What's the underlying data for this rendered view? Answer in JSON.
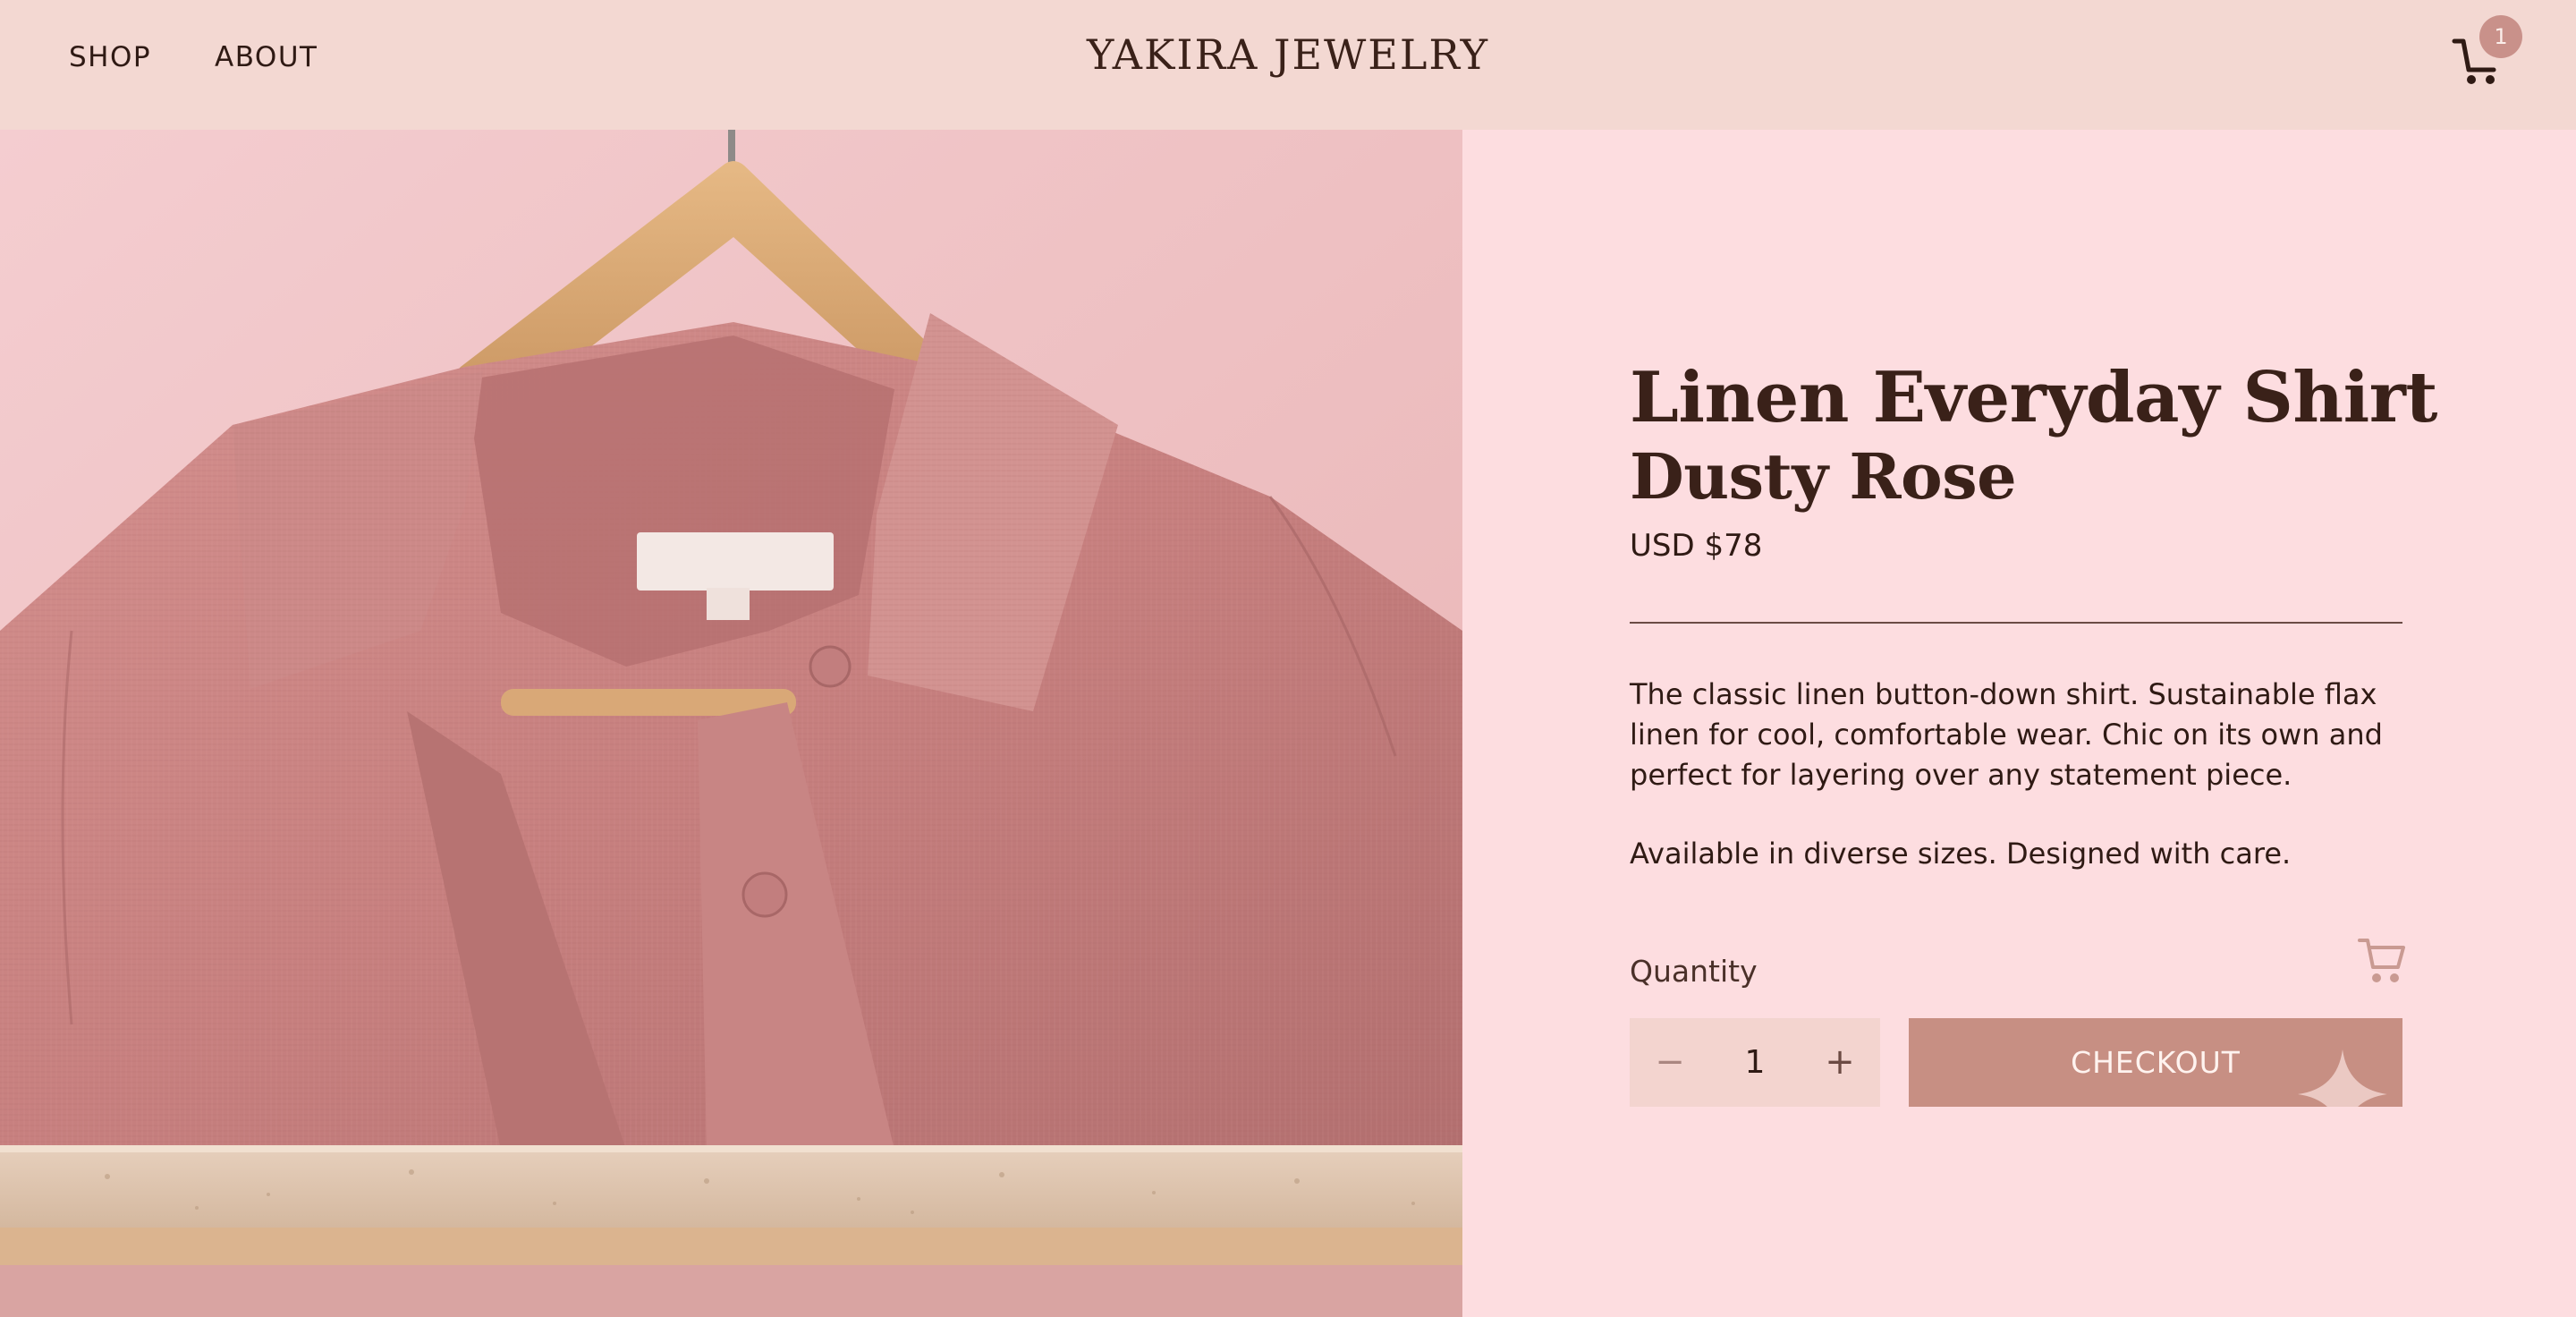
{
  "header": {
    "nav": [
      {
        "label": "SHOP"
      },
      {
        "label": "ABOUT"
      }
    ],
    "brand": "YAKIRA JEWELRY",
    "cart_count": "1"
  },
  "product": {
    "title_line1": "Linen Everyday Shirt",
    "title_line2": "Dusty Rose",
    "price": "USD $78",
    "description": [
      "The classic linen button-down shirt. Sustainable flax linen for cool, comfortable wear. Chic on its own and perfect for layering over any statement piece.",
      "Available in diverse sizes. Designed with care."
    ],
    "quantity_label": "Quantity",
    "quantity_value": "1",
    "decrement_symbol": "−",
    "increment_symbol": "+",
    "checkout_label": "CHECKOUT"
  },
  "icons": {
    "header_cart": "cart-icon",
    "add_to_cart": "cart-icon",
    "decrement": "minus-icon",
    "increment": "plus-icon",
    "sparkle": "sparkle-icon"
  },
  "colors": {
    "header_bg": "#f3d8d2",
    "panel_bg": "#fddde0",
    "text_dark": "#2f1a14",
    "accent": "#c78f83",
    "stepper_bg": "#f3d4cf",
    "badge_bg": "#c9918a"
  }
}
